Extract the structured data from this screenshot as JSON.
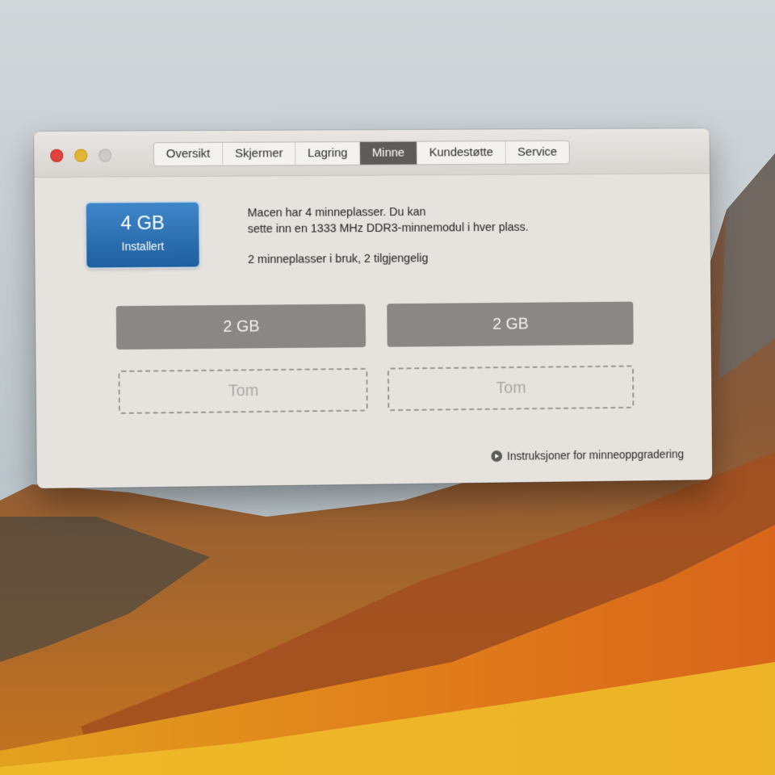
{
  "window": {
    "tabs": [
      {
        "label": "Oversikt",
        "active": false
      },
      {
        "label": "Skjermer",
        "active": false
      },
      {
        "label": "Lagring",
        "active": false
      },
      {
        "label": "Minne",
        "active": true
      },
      {
        "label": "Kundestøtte",
        "active": false
      },
      {
        "label": "Service",
        "active": false
      }
    ]
  },
  "memory": {
    "badge_value": "4 GB",
    "badge_label": "Installert",
    "info_line1": "Macen har 4 minneplasser. Du kan",
    "info_line2": "sette inn en 1333 MHz DDR3-minnemodul i hver plass.",
    "info_line3": "2 minneplasser i bruk, 2 tilgjengelig",
    "slots": [
      {
        "label": "2 GB",
        "state": "filled"
      },
      {
        "label": "2 GB",
        "state": "filled"
      },
      {
        "label": "Tom",
        "state": "empty"
      },
      {
        "label": "Tom",
        "state": "empty"
      }
    ],
    "upgrade_link": "Instruksjoner for minneoppgradering"
  },
  "colors": {
    "accent_badge": "#2b72b4",
    "active_tab": "#5f5b59",
    "slot_filled": "#8a8785"
  }
}
